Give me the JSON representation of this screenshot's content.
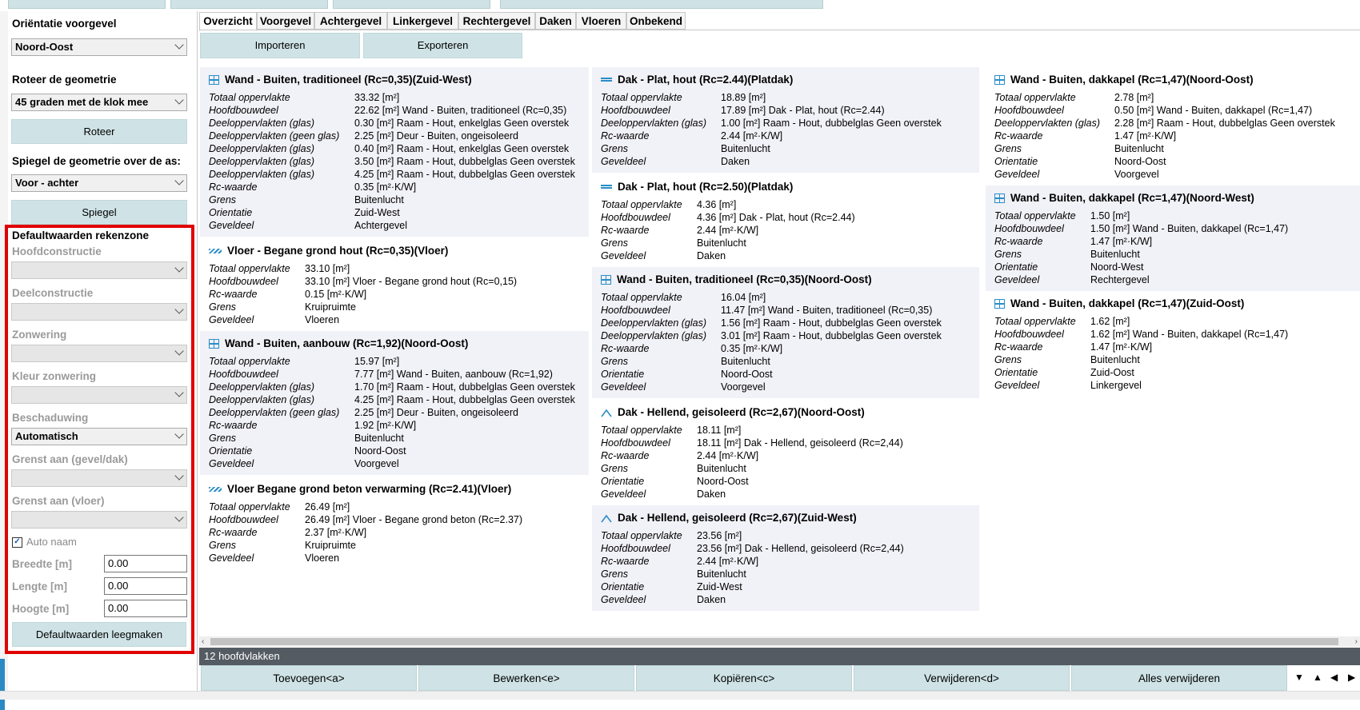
{
  "left_panel": {
    "orientation_label": "Oriëntatie voorgevel",
    "orientation_value": "Noord-Oost",
    "rotate_label": "Roteer de geometrie",
    "rotate_value": "45 graden met de klok mee",
    "rotate_button": "Roteer",
    "mirror_label": "Spiegel de geometrie over de as:",
    "mirror_value": "Voor - achter",
    "mirror_button": "Spiegel",
    "defaults_title": "Defaultwaarden rekenzone",
    "hoofdconstructie_label": "Hoofdconstructie",
    "deelconstructie_label": "Deelconstructie",
    "zonwering_label": "Zonwering",
    "kleur_zonwering_label": "Kleur zonwering",
    "beschaduwing_label": "Beschaduwing",
    "beschaduwing_value": "Automatisch",
    "grenst_gevel_label": "Grenst aan (gevel/dak)",
    "grenst_vloer_label": "Grenst aan (vloer)",
    "auto_naam_label": "Auto naam",
    "auto_naam_checked": "✓",
    "breedte_label": "Breedte [m]",
    "breedte_value": "0.00",
    "lengte_label": "Lengte [m]",
    "lengte_value": "0.00",
    "hoogte_label": "Hoogte [m]",
    "hoogte_value": "0.00",
    "clear_button": "Defaultwaarden leegmaken"
  },
  "tabs": [
    "Overzicht",
    "Voorgevel",
    "Achtergevel",
    "Linkergevel",
    "Rechtergevel",
    "Daken",
    "Vloeren",
    "Onbekend"
  ],
  "toolbar": {
    "import_label": "Importeren",
    "export_label": "Exporteren"
  },
  "cards": [
    {
      "icon": "wall-icon",
      "title": "Wand - Buiten, traditioneel (Rc=0,35)(Zuid-West)",
      "rows": [
        {
          "k": "Totaal oppervlakte",
          "v": "33.32 [m²]"
        },
        {
          "k": "Hoofdbouwdeel",
          "v": "22.62 [m²] Wand - Buiten, traditioneel (Rc=0,35)"
        },
        {
          "k": "Deeloppervlakten (glas)",
          "v": "0.30 [m²] Raam - Hout, enkelglas Geen overstek"
        },
        {
          "k": "Deeloppervlakten (geen glas)",
          "v": "2.25 [m²] Deur - Buiten, ongeisoleerd"
        },
        {
          "k": "Deeloppervlakten (glas)",
          "v": "0.40 [m²] Raam - Hout, enkelglas Geen overstek"
        },
        {
          "k": "Deeloppervlakten (glas)",
          "v": "3.50 [m²] Raam - Hout, dubbelglas Geen overstek"
        },
        {
          "k": "Deeloppervlakten (glas)",
          "v": "4.25 [m²] Raam - Hout, dubbelglas Geen overstek"
        },
        {
          "k": "Rc-waarde",
          "v": "0.35 [m²·K/W]"
        },
        {
          "k": "Grens",
          "v": "Buitenlucht"
        },
        {
          "k": "Orientatie",
          "v": "Zuid-West"
        },
        {
          "k": "Geveldeel",
          "v": "Achtergevel"
        }
      ]
    },
    {
      "icon": "floor-icon",
      "title": "Vloer - Begane grond hout (Rc=0,35)(Vloer)",
      "rows": [
        {
          "k": "Totaal oppervlakte",
          "v": "33.10 [m²]"
        },
        {
          "k": "Hoofdbouwdeel",
          "v": "33.10 [m²] Vloer - Begane grond hout (Rc=0,15)"
        },
        {
          "k": "Rc-waarde",
          "v": "0.15 [m²·K/W]"
        },
        {
          "k": "Grens",
          "v": "Kruipruimte"
        },
        {
          "k": "Geveldeel",
          "v": "Vloeren"
        }
      ]
    },
    {
      "icon": "wall-icon",
      "title": "Wand - Buiten, aanbouw (Rc=1,92)(Noord-Oost)",
      "rows": [
        {
          "k": "Totaal oppervlakte",
          "v": "15.97 [m²]"
        },
        {
          "k": "Hoofdbouwdeel",
          "v": "7.77 [m²] Wand - Buiten, aanbouw (Rc=1,92)"
        },
        {
          "k": "Deeloppervlakten (glas)",
          "v": "1.70 [m²] Raam - Hout, dubbelglas Geen overstek"
        },
        {
          "k": "Deeloppervlakten (glas)",
          "v": "4.25 [m²] Raam - Hout, dubbelglas Geen overstek"
        },
        {
          "k": "Deeloppervlakten (geen glas)",
          "v": "2.25 [m²] Deur - Buiten, ongeisoleerd"
        },
        {
          "k": "Rc-waarde",
          "v": "1.92 [m²·K/W]"
        },
        {
          "k": "Grens",
          "v": "Buitenlucht"
        },
        {
          "k": "Orientatie",
          "v": "Noord-Oost"
        },
        {
          "k": "Geveldeel",
          "v": "Voorgevel"
        }
      ]
    },
    {
      "icon": "floor-icon",
      "title": "Vloer Begane grond beton verwarming (Rc=2.41)(Vloer)",
      "rows": [
        {
          "k": "Totaal oppervlakte",
          "v": "26.49 [m²]"
        },
        {
          "k": "Hoofdbouwdeel",
          "v": "26.49 [m²] Vloer - Begane grond beton (Rc=2.37)"
        },
        {
          "k": "Rc-waarde",
          "v": "2.37 [m²·K/W]"
        },
        {
          "k": "Grens",
          "v": "Kruipruimte"
        },
        {
          "k": "Geveldeel",
          "v": "Vloeren"
        }
      ]
    },
    {
      "icon": "flat-roof-icon",
      "title": "Dak - Plat, hout (Rc=2.44)(Platdak)",
      "rows": [
        {
          "k": "Totaal oppervlakte",
          "v": "18.89 [m²]"
        },
        {
          "k": "Hoofdbouwdeel",
          "v": "17.89 [m²] Dak - Plat, hout (Rc=2.44)"
        },
        {
          "k": "Deeloppervlakten (glas)",
          "v": "1.00 [m²] Raam - Hout, dubbelglas Geen overstek"
        },
        {
          "k": "Rc-waarde",
          "v": "2.44 [m²·K/W]"
        },
        {
          "k": "Grens",
          "v": "Buitenlucht"
        },
        {
          "k": "Geveldeel",
          "v": "Daken"
        }
      ]
    },
    {
      "icon": "flat-roof-icon",
      "title": "Dak - Plat, hout (Rc=2.50)(Platdak)",
      "rows": [
        {
          "k": "Totaal oppervlakte",
          "v": "4.36 [m²]"
        },
        {
          "k": "Hoofdbouwdeel",
          "v": "4.36 [m²] Dak - Plat, hout (Rc=2.44)"
        },
        {
          "k": "Rc-waarde",
          "v": "2.44 [m²·K/W]"
        },
        {
          "k": "Grens",
          "v": "Buitenlucht"
        },
        {
          "k": "Geveldeel",
          "v": "Daken"
        }
      ]
    },
    {
      "icon": "wall-icon",
      "title": "Wand - Buiten, traditioneel (Rc=0,35)(Noord-Oost)",
      "rows": [
        {
          "k": "Totaal oppervlakte",
          "v": "16.04 [m²]"
        },
        {
          "k": "Hoofdbouwdeel",
          "v": "11.47 [m²] Wand - Buiten, traditioneel (Rc=0,35)"
        },
        {
          "k": "Deeloppervlakten (glas)",
          "v": "1.56 [m²] Raam - Hout, dubbelglas Geen overstek"
        },
        {
          "k": "Deeloppervlakten (glas)",
          "v": "3.01 [m²] Raam - Hout, dubbelglas Geen overstek"
        },
        {
          "k": "Rc-waarde",
          "v": "0.35 [m²·K/W]"
        },
        {
          "k": "Grens",
          "v": "Buitenlucht"
        },
        {
          "k": "Orientatie",
          "v": "Noord-Oost"
        },
        {
          "k": "Geveldeel",
          "v": "Voorgevel"
        }
      ]
    },
    {
      "icon": "pitched-roof-icon",
      "title": "Dak - Hellend, geisoleerd (Rc=2,67)(Noord-Oost)",
      "rows": [
        {
          "k": "Totaal oppervlakte",
          "v": "18.11 [m²]"
        },
        {
          "k": "Hoofdbouwdeel",
          "v": "18.11 [m²] Dak - Hellend, geisoleerd (Rc=2,44)"
        },
        {
          "k": "Rc-waarde",
          "v": "2.44 [m²·K/W]"
        },
        {
          "k": "Grens",
          "v": "Buitenlucht"
        },
        {
          "k": "Orientatie",
          "v": "Noord-Oost"
        },
        {
          "k": "Geveldeel",
          "v": "Daken"
        }
      ]
    },
    {
      "icon": "pitched-roof-icon",
      "title": "Dak - Hellend, geisoleerd (Rc=2,67)(Zuid-West)",
      "rows": [
        {
          "k": "Totaal oppervlakte",
          "v": "23.56 [m²]"
        },
        {
          "k": "Hoofdbouwdeel",
          "v": "23.56 [m²] Dak - Hellend, geisoleerd (Rc=2,44)"
        },
        {
          "k": "Rc-waarde",
          "v": "2.44 [m²·K/W]"
        },
        {
          "k": "Grens",
          "v": "Buitenlucht"
        },
        {
          "k": "Orientatie",
          "v": "Zuid-West"
        },
        {
          "k": "Geveldeel",
          "v": "Daken"
        }
      ]
    },
    {
      "icon": "wall-icon",
      "title": "Wand - Buiten, dakkapel (Rc=1,47)(Noord-Oost)",
      "rows": [
        {
          "k": "Totaal oppervlakte",
          "v": "2.78 [m²]"
        },
        {
          "k": "Hoofdbouwdeel",
          "v": "0.50 [m²] Wand - Buiten, dakkapel (Rc=1,47)"
        },
        {
          "k": "Deeloppervlakten (glas)",
          "v": "2.28 [m²] Raam - Hout, dubbelglas Geen overstek"
        },
        {
          "k": "Rc-waarde",
          "v": "1.47 [m²·K/W]"
        },
        {
          "k": "Grens",
          "v": "Buitenlucht"
        },
        {
          "k": "Orientatie",
          "v": "Noord-Oost"
        },
        {
          "k": "Geveldeel",
          "v": "Voorgevel"
        }
      ]
    },
    {
      "icon": "wall-icon",
      "title": "Wand - Buiten, dakkapel (Rc=1,47)(Noord-West)",
      "rows": [
        {
          "k": "Totaal oppervlakte",
          "v": "1.50 [m²]"
        },
        {
          "k": "Hoofdbouwdeel",
          "v": "1.50 [m²] Wand - Buiten, dakkapel (Rc=1,47)"
        },
        {
          "k": "Rc-waarde",
          "v": "1.47 [m²·K/W]"
        },
        {
          "k": "Grens",
          "v": "Buitenlucht"
        },
        {
          "k": "Orientatie",
          "v": "Noord-West"
        },
        {
          "k": "Geveldeel",
          "v": "Rechtergevel"
        }
      ]
    },
    {
      "icon": "wall-icon",
      "title": "Wand - Buiten, dakkapel (Rc=1,47)(Zuid-Oost)",
      "rows": [
        {
          "k": "Totaal oppervlakte",
          "v": "1.62 [m²]"
        },
        {
          "k": "Hoofdbouwdeel",
          "v": "1.62 [m²] Wand - Buiten, dakkapel (Rc=1,47)"
        },
        {
          "k": "Rc-waarde",
          "v": "1.47 [m²·K/W]"
        },
        {
          "k": "Grens",
          "v": "Buitenlucht"
        },
        {
          "k": "Orientatie",
          "v": "Zuid-Oost"
        },
        {
          "k": "Geveldeel",
          "v": "Linkergevel"
        }
      ]
    }
  ],
  "status": {
    "count_text": "12 hoofdvlakken"
  },
  "bottom": {
    "add": "Toevoegen<a>",
    "edit": "Bewerken<e>",
    "copy": "Kopiëren<c>",
    "delete": "Verwijderen<d>",
    "delete_all": "Alles verwijderen",
    "nav_down": "▼",
    "nav_up": "▲",
    "nav_left": "◀",
    "nav_right": "▶"
  },
  "colors": {
    "accent": "#2a8ec8",
    "button_bg": "#cfe3e6",
    "card_bg": "#f1f1f8",
    "highlight": "#e00000",
    "statusbar": "#555b62"
  }
}
